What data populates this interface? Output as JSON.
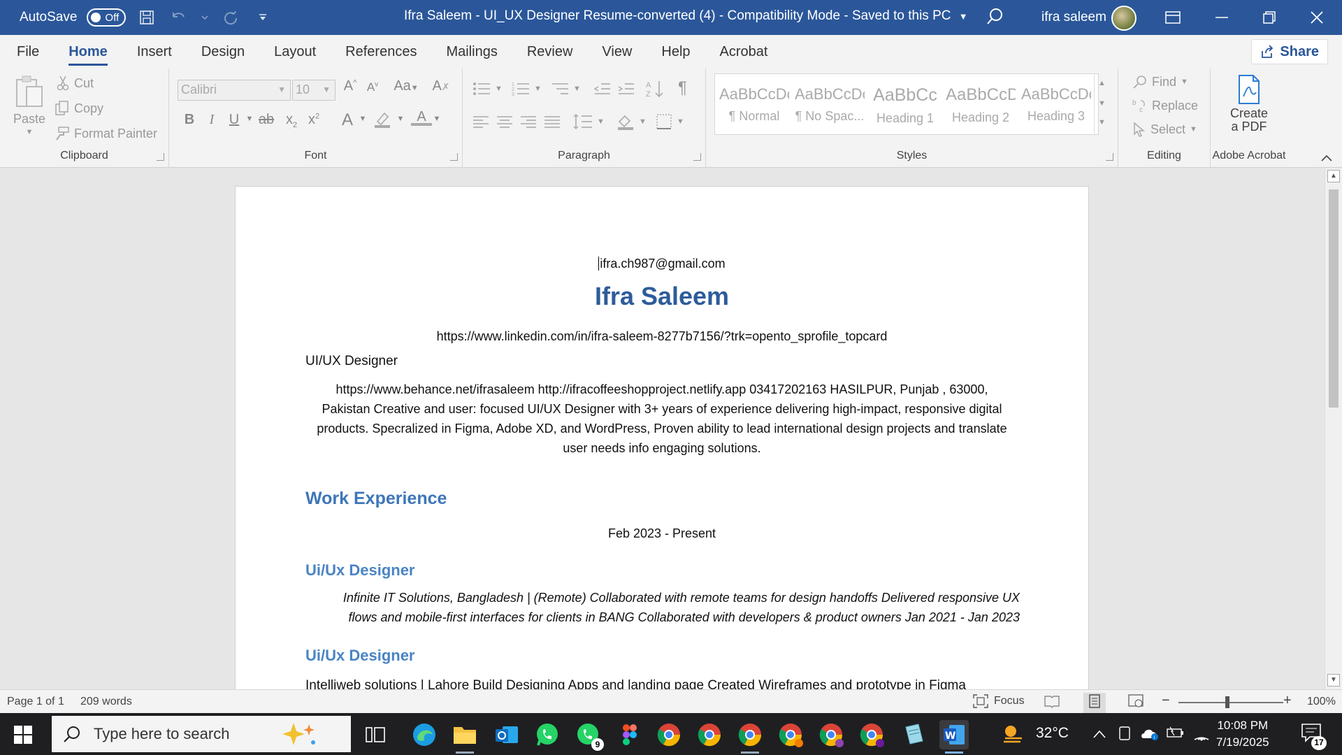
{
  "titlebar": {
    "autosave_label": "AutoSave",
    "autosave_state": "Off",
    "doc_title": "Ifra Saleem - UI_UX Designer Resume-converted (4)  -  Compatibility Mode  -  Saved to this PC",
    "user_name": "ifra saleem"
  },
  "menu": {
    "tabs": [
      "File",
      "Home",
      "Insert",
      "Design",
      "Layout",
      "References",
      "Mailings",
      "Review",
      "View",
      "Help",
      "Acrobat"
    ],
    "active": "Home",
    "share_label": "Share"
  },
  "ribbon": {
    "clipboard": {
      "paste": "Paste",
      "cut": "Cut",
      "copy": "Copy",
      "format_painter": "Format Painter",
      "label": "Clipboard"
    },
    "font": {
      "font_name": "Calibri",
      "font_size": "10",
      "label": "Font"
    },
    "paragraph": {
      "label": "Paragraph"
    },
    "styles": {
      "label": "Styles",
      "items": [
        {
          "sample": "AaBbCcDc",
          "name": "¶ Normal"
        },
        {
          "sample": "AaBbCcDc",
          "name": "¶ No Spac..."
        },
        {
          "sample": "AaBbCc",
          "name": "Heading 1"
        },
        {
          "sample": "AaBbCcD",
          "name": "Heading 2"
        },
        {
          "sample": "AaBbCcDc",
          "name": "Heading 3"
        }
      ]
    },
    "editing": {
      "find": "Find",
      "replace": "Replace",
      "select": "Select",
      "label": "Editing"
    },
    "acrobat": {
      "create_pdf_line1": "Create",
      "create_pdf_line2": "a PDF",
      "label": "Adobe Acrobat"
    }
  },
  "document": {
    "email": "ifra.ch987@gmail.com",
    "name": "Ifra Saleem",
    "linkedin": "https://www.linkedin.com/in/ifra-saleem-8277b7156/?trk=opento_sprofile_topcard",
    "role": "UI/UX Designer",
    "summary_lines": [
      "https://www.behance.net/ifrasaleem http://ifracoffeeshopproject.netlify.app 03417202163 HASILPUR, Punjab , 63000,",
      "Pakistan Creative and user: focused UI/UX Designer with 3+ years of experience delivering high-impact, responsive digital",
      "products. Specralized in Figma, Adobe XD, and WordPress, Proven ability to lead international design projects and translate",
      "user needs info engaging solutions."
    ],
    "work_heading": "Work Experience",
    "date1": "Feb 2023 - Present",
    "job1_title": "Ui/Ux Designer",
    "job1_lines": [
      "Infinite IT Solutions, Bangladesh | (Remote) Collaborated with remote teams for design handoffs Delivered responsive UX",
      "flows and mobile-first interfaces for clients in BANG Collaborated with developers & product owners Jan 2021 - Jan 2023"
    ],
    "job2_title": "Ui/Ux Designer",
    "job2_line": "Intelliweb solutions | Lahore Build Designing Apps and landing page Created Wireframes and prototype in Figma"
  },
  "statusbar": {
    "page": "Page 1 of 1",
    "words": "209 words",
    "focus": "Focus",
    "zoom": "100%"
  },
  "taskbar": {
    "search_placeholder": "Type here to search",
    "temperature": "32°C",
    "time": "10:08 PM",
    "date": "7/19/2025",
    "notification_count": "17",
    "whatsapp_badge": "9"
  }
}
